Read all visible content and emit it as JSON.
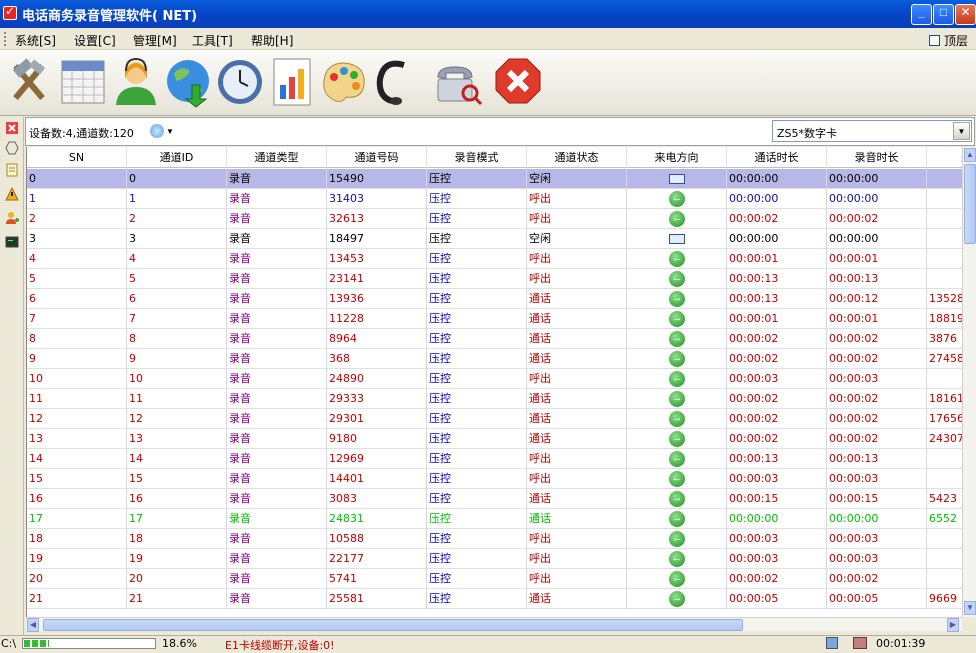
{
  "window": {
    "title": "电话商务录音管理软件( NET)"
  },
  "menu": {
    "items": [
      "系统[S]",
      "设置[C]",
      "管理[M]",
      "工具[T]",
      "帮助[H]"
    ],
    "pin_label": "顶层"
  },
  "info": {
    "text": "设备数:4,通道数:120",
    "card_select": "ZS5*数字卡"
  },
  "columns": [
    "SN",
    "通道ID",
    "通道类型",
    "通道号码",
    "录音模式",
    "通道状态",
    "来电方向",
    "通话时长",
    "录音时长",
    "来"
  ],
  "rows": [
    {
      "sn": "0",
      "id": "0",
      "type": "录音",
      "num": "15490",
      "mode": "压控",
      "state": "空闲",
      "dir": "none",
      "talk": "00:00:00",
      "rec": "00:00:00",
      "caller": "",
      "color": "#000000",
      "sel": true
    },
    {
      "sn": "1",
      "id": "1",
      "type": "录音",
      "num": "31403",
      "mode": "压控",
      "state": "呼出",
      "dir": "out",
      "talk": "00:00:00",
      "rec": "00:00:00",
      "caller": "",
      "color": "#1010a0"
    },
    {
      "sn": "2",
      "id": "2",
      "type": "录音",
      "num": "32613",
      "mode": "压控",
      "state": "呼出",
      "dir": "out",
      "talk": "00:00:02",
      "rec": "00:00:02",
      "caller": "",
      "color": "#c00000"
    },
    {
      "sn": "3",
      "id": "3",
      "type": "录音",
      "num": "18497",
      "mode": "压控",
      "state": "空闲",
      "dir": "none",
      "talk": "00:00:00",
      "rec": "00:00:00",
      "caller": "",
      "color": "#000000"
    },
    {
      "sn": "4",
      "id": "4",
      "type": "录音",
      "num": "13453",
      "mode": "压控",
      "state": "呼出",
      "dir": "out",
      "talk": "00:00:01",
      "rec": "00:00:01",
      "caller": "",
      "color": "#c00000"
    },
    {
      "sn": "5",
      "id": "5",
      "type": "录音",
      "num": "23141",
      "mode": "压控",
      "state": "呼出",
      "dir": "out",
      "talk": "00:00:13",
      "rec": "00:00:13",
      "caller": "",
      "color": "#c00000"
    },
    {
      "sn": "6",
      "id": "6",
      "type": "录音",
      "num": "13936",
      "mode": "压控",
      "state": "通话",
      "dir": "in",
      "talk": "00:00:13",
      "rec": "00:00:12",
      "caller": "13528",
      "color": "#c00000"
    },
    {
      "sn": "7",
      "id": "7",
      "type": "录音",
      "num": "11228",
      "mode": "压控",
      "state": "通话",
      "dir": "in",
      "talk": "00:00:01",
      "rec": "00:00:01",
      "caller": "18819",
      "color": "#c00000"
    },
    {
      "sn": "8",
      "id": "8",
      "type": "录音",
      "num": "8964",
      "mode": "压控",
      "state": "通话",
      "dir": "in",
      "talk": "00:00:02",
      "rec": "00:00:02",
      "caller": "3876",
      "color": "#c00000"
    },
    {
      "sn": "9",
      "id": "9",
      "type": "录音",
      "num": "368",
      "mode": "压控",
      "state": "通话",
      "dir": "in",
      "talk": "00:00:02",
      "rec": "00:00:02",
      "caller": "27458",
      "color": "#c00000"
    },
    {
      "sn": "10",
      "id": "10",
      "type": "录音",
      "num": "24890",
      "mode": "压控",
      "state": "呼出",
      "dir": "out",
      "talk": "00:00:03",
      "rec": "00:00:03",
      "caller": "",
      "color": "#c00000"
    },
    {
      "sn": "11",
      "id": "11",
      "type": "录音",
      "num": "29333",
      "mode": "压控",
      "state": "通话",
      "dir": "in",
      "talk": "00:00:02",
      "rec": "00:00:02",
      "caller": "18161",
      "color": "#c00000"
    },
    {
      "sn": "12",
      "id": "12",
      "type": "录音",
      "num": "29301",
      "mode": "压控",
      "state": "通话",
      "dir": "in",
      "talk": "00:00:02",
      "rec": "00:00:02",
      "caller": "17656",
      "color": "#c00000"
    },
    {
      "sn": "13",
      "id": "13",
      "type": "录音",
      "num": "9180",
      "mode": "压控",
      "state": "通话",
      "dir": "in",
      "talk": "00:00:02",
      "rec": "00:00:02",
      "caller": "24307",
      "color": "#c00000"
    },
    {
      "sn": "14",
      "id": "14",
      "type": "录音",
      "num": "12969",
      "mode": "压控",
      "state": "呼出",
      "dir": "out",
      "talk": "00:00:13",
      "rec": "00:00:13",
      "caller": "",
      "color": "#c00000"
    },
    {
      "sn": "15",
      "id": "15",
      "type": "录音",
      "num": "14401",
      "mode": "压控",
      "state": "呼出",
      "dir": "out",
      "talk": "00:00:03",
      "rec": "00:00:03",
      "caller": "",
      "color": "#c00000"
    },
    {
      "sn": "16",
      "id": "16",
      "type": "录音",
      "num": "3083",
      "mode": "压控",
      "state": "通话",
      "dir": "in",
      "talk": "00:00:15",
      "rec": "00:00:15",
      "caller": "5423",
      "color": "#c00000"
    },
    {
      "sn": "17",
      "id": "17",
      "type": "录音",
      "num": "24831",
      "mode": "压控",
      "state": "通话",
      "dir": "in",
      "talk": "00:00:00",
      "rec": "00:00:00",
      "caller": "6552",
      "color": "#00c000"
    },
    {
      "sn": "18",
      "id": "18",
      "type": "录音",
      "num": "10588",
      "mode": "压控",
      "state": "呼出",
      "dir": "out",
      "talk": "00:00:03",
      "rec": "00:00:03",
      "caller": "",
      "color": "#c00000"
    },
    {
      "sn": "19",
      "id": "19",
      "type": "录音",
      "num": "22177",
      "mode": "压控",
      "state": "呼出",
      "dir": "out",
      "talk": "00:00:03",
      "rec": "00:00:03",
      "caller": "",
      "color": "#c00000"
    },
    {
      "sn": "20",
      "id": "20",
      "type": "录音",
      "num": "5741",
      "mode": "压控",
      "state": "呼出",
      "dir": "out",
      "talk": "00:00:02",
      "rec": "00:00:02",
      "caller": "",
      "color": "#c00000"
    },
    {
      "sn": "21",
      "id": "21",
      "type": "录音",
      "num": "25581",
      "mode": "压控",
      "state": "通话",
      "dir": "in",
      "talk": "00:00:05",
      "rec": "00:00:05",
      "caller": "9669",
      "color": "#c00000"
    }
  ],
  "status": {
    "drive": "C:\\",
    "progress": 0.186,
    "percent": "18.6%",
    "message": "E1卡线缆断开,设备:0!",
    "clock": "00:01:39"
  }
}
